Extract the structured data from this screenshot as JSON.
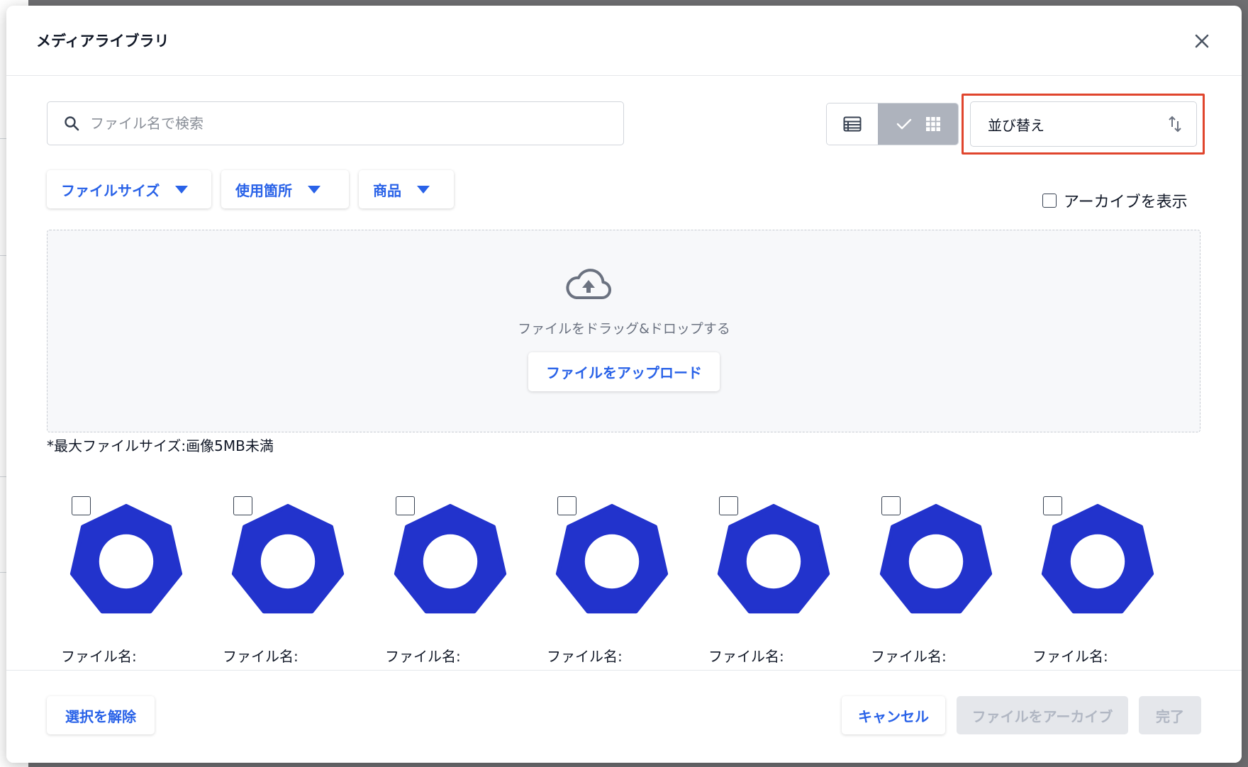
{
  "modal": {
    "title": "メディアライブラリ"
  },
  "search": {
    "placeholder": "ファイル名で検索",
    "value": ""
  },
  "view_toggle": {
    "active": "grid"
  },
  "sort": {
    "label": "並び替え"
  },
  "filters": [
    {
      "label": "ファイルサイズ"
    },
    {
      "label": "使用箇所"
    },
    {
      "label": "商品"
    }
  ],
  "archive_toggle": {
    "label": "アーカイブを表示",
    "checked": false
  },
  "dropzone": {
    "text": "ファイルをドラッグ&ドロップする",
    "upload_label": "ファイルをアップロード"
  },
  "max_size_note": "*最大ファイルサイズ:画像5MB未満",
  "files": [
    {
      "name_label": "ファイル名:",
      "checked": false
    },
    {
      "name_label": "ファイル名:",
      "checked": false
    },
    {
      "name_label": "ファイル名:",
      "checked": false
    },
    {
      "name_label": "ファイル名:",
      "checked": false
    },
    {
      "name_label": "ファイル名:",
      "checked": false
    },
    {
      "name_label": "ファイル名:",
      "checked": false
    },
    {
      "name_label": "ファイル名:",
      "checked": false
    }
  ],
  "footer": {
    "deselect_label": "選択を解除",
    "cancel_label": "キャンセル",
    "archive_label": "ファイルをアーカイブ",
    "done_label": "完了"
  },
  "colors": {
    "accent": "#2962e8",
    "highlight": "#e0452d",
    "thumbnail": "#2233cc"
  },
  "icons": {
    "close": "close-icon",
    "search": "search-icon",
    "list_view": "list-view-icon",
    "grid_view": "grid-view-icon",
    "check": "check-icon",
    "sort": "sort-arrows-icon",
    "dropdown": "caret-down-icon",
    "upload": "cloud-upload-icon"
  }
}
